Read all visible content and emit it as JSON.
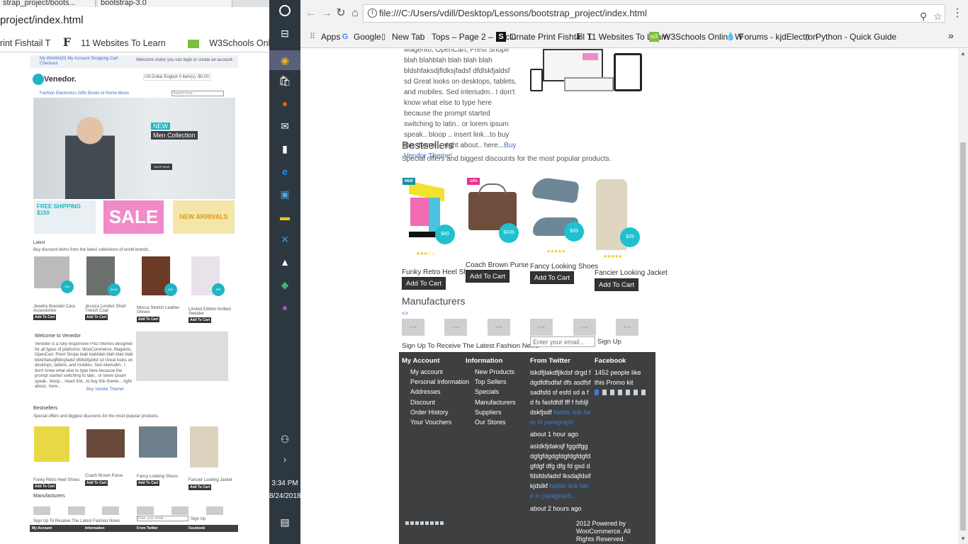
{
  "left_window": {
    "tabs": [
      "strap_project/boots...",
      "bootstrap-3.0"
    ],
    "url": "project/index.html",
    "bookmarks": [
      "rint Fishtail T",
      "11 Websites To Learn",
      "W3Schools Online W"
    ],
    "page": {
      "top_links": "My Wishlist(0) My Account Shopping Cart Checkout",
      "welcome": "Welcome visitor you can login or create an account.",
      "currency": "US Dollar  English  0 item(s) -$0.00",
      "logo": "Venedor.",
      "nav": "Fashion Electronics Gifts Books Al  Home Music",
      "search_placeholder": "Search here...",
      "hero_new": "NEW",
      "hero_title": "Men Collection",
      "hero_btn": "SHOP NOW",
      "banner1": "FREE SHIPPING $150",
      "banner2": "SALE",
      "banner3": "NEW ARRIVALS",
      "latest_title": "Latest",
      "latest_sub": "Buy discount items from the latest collections of world brands..",
      "latest_products": [
        {
          "name": "Jewelry Bracelet Cara Accessories",
          "price": "$40"
        },
        {
          "name": "Jessica London Short Trench Coat",
          "price": "$435"
        },
        {
          "name": "Mocca Stretch Leather Gloves",
          "price": "$39"
        },
        {
          "name": "Limited Edition Knitted Sweater",
          "price": "$39"
        }
      ],
      "add_to_cart": "Add To Cart",
      "welcome_title": "Welcome to Venedor",
      "welcome_text": "Venedor is a fully responsive PSD themes designed for all types of platforms: WooCommerce, Magento, OpenCart, Prest Shope blah blahblah blah blah blah bldshfaksdjfldksjfadsf dfdlskfjaldsf sd Great looks on desktops, tablets, and mobiles. Sed interiudm.. I don't know what else to type here because the prompt started switching to latin.. or lorem ipsum speak.. bloop .. insert link...to buy this theme... right about.. here...",
      "welcome_link": "Buy Vendor Theme!",
      "bestsellers": "Bestsellers",
      "bestsellers_sub": "Special offers and biggest discounts for the most popular products.",
      "best_names": [
        "Funky Retro Heel Shoes",
        "Coach Brown Purse",
        "Fancy Looking Shoes",
        "Fancier Looking Jacket"
      ],
      "manufacturers": "Manufacturers",
      "signup": "Sign Up To Receive The Latest Fashion News",
      "email_placeholder": "Enter your email...",
      "signup_btn": "Sign Up",
      "footer_heads": [
        "My Account",
        "Information",
        "From Twitter",
        "Facebook"
      ]
    }
  },
  "taskbar": {
    "time": "3:34 PM",
    "date": "8/24/2018"
  },
  "right_window": {
    "url": "file:///C:/Users/vdill/Desktop/Lessons/bootstrap_project/index.html",
    "bookmarks": [
      {
        "label": "Apps",
        "icon": "apps-icon"
      },
      {
        "label": "Google",
        "icon": "google-icon"
      },
      {
        "label": "New Tab",
        "icon": "page-icon"
      },
      {
        "label": "Tops – Page 2 – Exclu",
        "icon": "blank-icon"
      },
      {
        "label": "Ornate Print Fishtail T",
        "icon": "s-icon"
      },
      {
        "label": "11 Websites To Learn",
        "icon": "f-icon"
      },
      {
        "label": "W3Schools Online W",
        "icon": "w3-icon"
      },
      {
        "label": "Forums - kjdElectron",
        "icon": "drop-icon"
      },
      {
        "label": "Python - Quick Guide",
        "icon": "page-icon"
      }
    ],
    "more": "»",
    "page": {
      "para_text": "Magento, OpenCart, Prest Shope blah blahblah blah blah blah bldshfaksdjfldksjfadsf dfdlskfjaldsf sd Great looks on desktops, tablets, and mobiles. Sed interiudm.. I don't know what else to type here because the prompt started switching to latin.. or lorem ipsum speak.. bloop .. insert link...to buy this theme... right about.. here...",
      "para_link": "Buy Vendor Theme!",
      "bestsellers_title": "Bestsellers",
      "bestsellers_sub": "Special offers and biggest discounts for the most popular products.",
      "products": [
        {
          "name": "Funky Retro Heel Shoes",
          "price": "$40",
          "badge": "NEW",
          "rating": 3.5
        },
        {
          "name": "Coach Brown Purse",
          "price": "$435",
          "badge": "-15%",
          "rating": 0
        },
        {
          "name": "Fancy Looking Shoes",
          "price": "$39",
          "badge": "",
          "rating": 5
        },
        {
          "name": "Fancier Looking Jacket",
          "price": "$39",
          "badge": "",
          "rating": 5
        }
      ],
      "add_to_cart": "Add To Cart",
      "manufacturers_title": "Manufacturers",
      "manufacturers_arrows": "<>",
      "manufacturer_logos": [
        "brnds",
        "brnds",
        "brnds",
        "brnds",
        "brnds",
        "brnds"
      ],
      "signup_text": "Sign Up To Receive The Latest Fashion News",
      "email_placeholder": "Enter your email...",
      "signup_btn": "Sign Up",
      "footer": {
        "my_account_title": "My Account",
        "my_account_links": [
          "My account",
          "Personal Information",
          "Addresses",
          "Discount",
          "Order History",
          "Your Vouchers"
        ],
        "information_title": "Information",
        "information_links": [
          "New Products",
          "Top Sellers",
          "Specials",
          "Manufacturers",
          "Suppliers",
          "Our Stores"
        ],
        "twitter_title": "From Twitter",
        "tweet1_text": "lskdfjlakdfjlkdsf drgd fdgdfdfsdfaf dfs asdfsf sadfsfd sf esfd sd a fd fs fasfdfdf fff f fsfdjldskfjsdf",
        "tweet1_link": "twitter link here in paragraph",
        "tweet1_time": "about 1 hour ago",
        "tweet2_text": "asldkfjdaksjf fggdfggdgfgfdgdgfdgfdgfdgfdgfdgf dfg dfg fd gsd dfdsfdsfadsf lksdajfdsifkjdslkf",
        "tweet2_link": "twitter link here in paragraph...",
        "tweet2_time": "about 2 hours ago",
        "facebook_title": "Facebook",
        "facebook_likes": "1452 people like this Promo kit",
        "powered": "2012 Powered by WooCommerce. All Rights Reserved."
      }
    }
  }
}
